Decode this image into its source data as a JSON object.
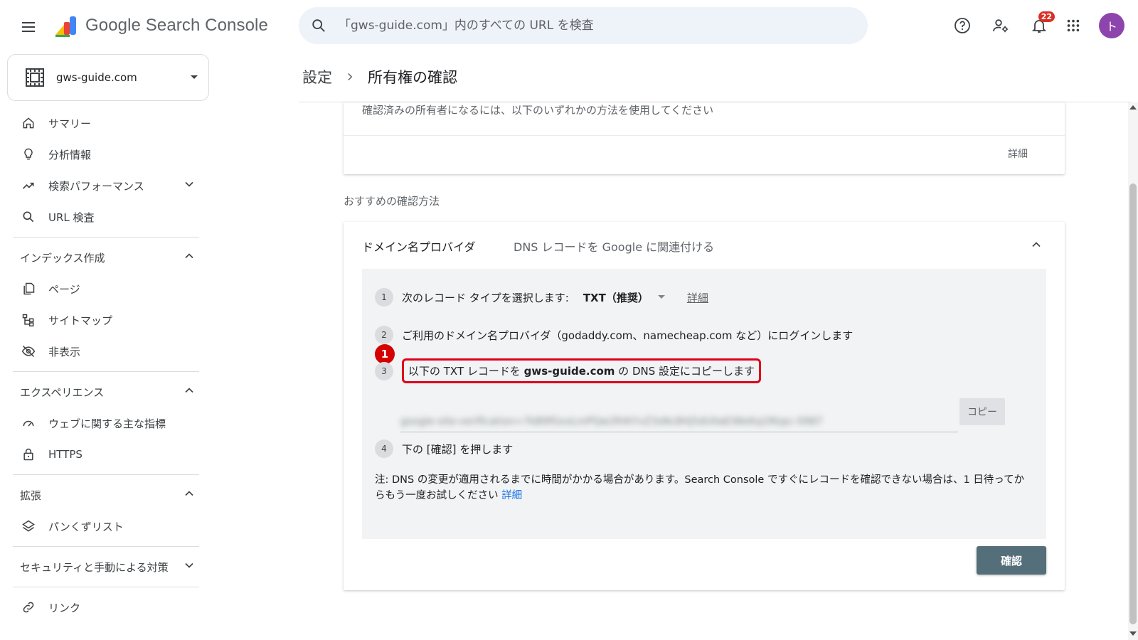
{
  "app": {
    "title": "Google Search Console"
  },
  "search": {
    "placeholder": "「gws-guide.com」内のすべての URL を検査"
  },
  "header": {
    "notifications_count": "22",
    "avatar_initial": "ト"
  },
  "property": {
    "name": "gws-guide.com"
  },
  "sidebar": {
    "top_items": [
      {
        "label": "サマリー",
        "icon": "home-icon"
      },
      {
        "label": "分析情報",
        "icon": "lightbulb-icon"
      },
      {
        "label": "検索パフォーマンス",
        "icon": "trending-up-icon"
      },
      {
        "label": "URL 検査",
        "icon": "search-icon"
      }
    ],
    "indexing": {
      "title": "インデックス作成",
      "items": [
        "ページ",
        "サイトマップ",
        "非表示"
      ]
    },
    "experience": {
      "title": "エクスペリエンス",
      "items": [
        "ウェブに関する主な指標",
        "HTTPS"
      ]
    },
    "enhancements": {
      "title": "拡張",
      "items": [
        "パンくずリスト"
      ]
    },
    "security": {
      "title": "セキュリティと手動による対策"
    },
    "links": {
      "label": "リンク"
    }
  },
  "breadcrumb": {
    "parent": "設定",
    "current": "所有権の確認"
  },
  "card1": {
    "description": "確認済みの所有者になるには、以下のいずれかの方法を使用してください",
    "more": "詳細"
  },
  "recommended": {
    "label": "おすすめの確認方法"
  },
  "method": {
    "title": "ドメイン名プロバイダ",
    "subtitle": "DNS レコードを Google に関連付ける",
    "steps": {
      "s1": {
        "num": "1",
        "text": "次のレコード タイプを選択します:",
        "select": "TXT（推奨）",
        "link": "詳細"
      },
      "s2": {
        "num": "2",
        "text": "ご利用のドメイン名プロバイダ（godaddy.com、namecheap.com など）にログインします"
      },
      "s3": {
        "num": "3",
        "pre": "以下の TXT レコードを ",
        "domain": "gws-guide.com",
        "post": " の DNS 設定にコピーします"
      },
      "s4": {
        "num": "4",
        "text": "下の [確認] を押します"
      }
    },
    "marker": "1",
    "txt_record": "google-site-verification=7kB9fGxxLmPQw2R4tYvZ3sNc8Hj5dU0aEiWoKq1Mzpc-0987",
    "copy_label": "コピー",
    "note": "注: DNS の変更が適用されるまでに時間がかかる場合があります。Search Console ですぐにレコードを確認できない場合は、1 日待ってからもう一度お試しください",
    "note_link": "詳細",
    "verify_label": "確認"
  }
}
